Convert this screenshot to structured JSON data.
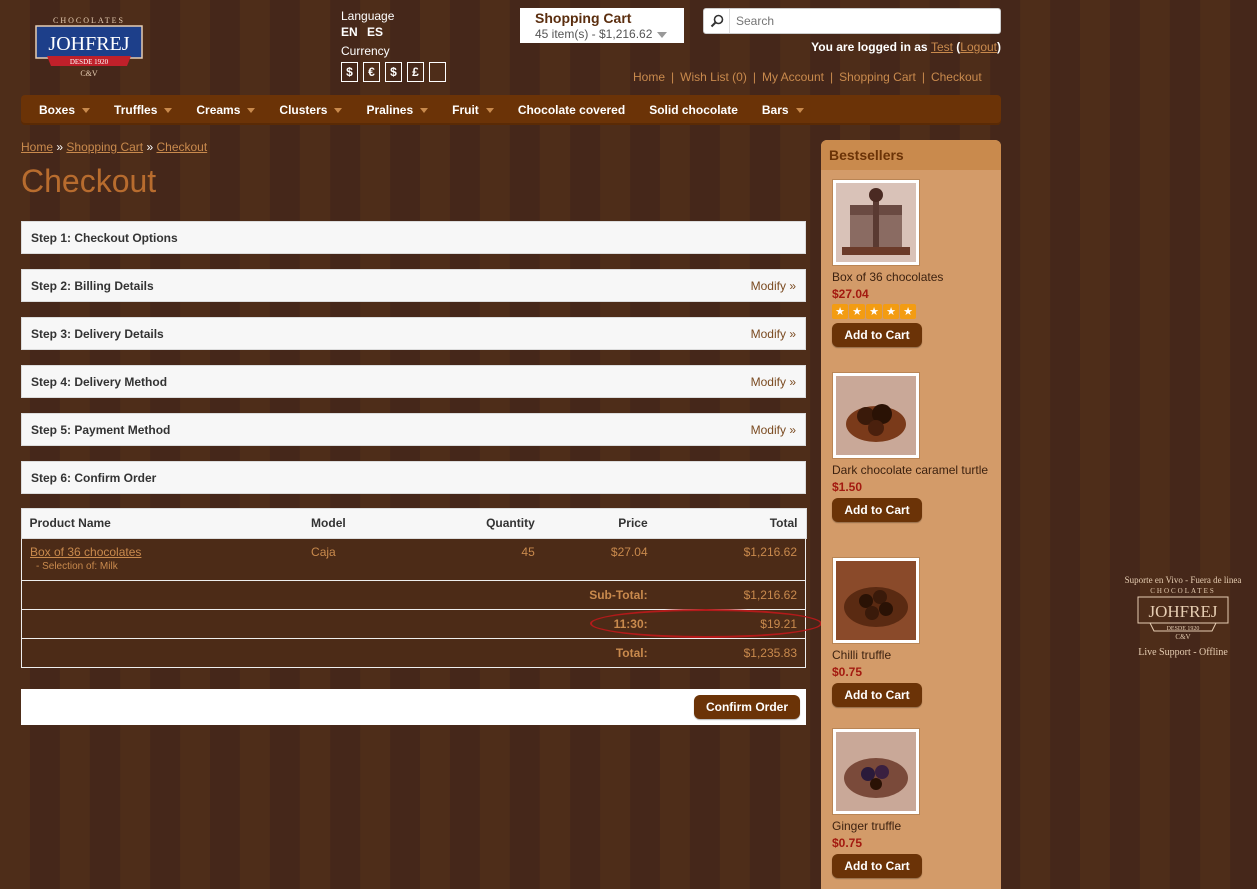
{
  "brand": {
    "top": "CHOCOLATES",
    "name": "JOHFREJ",
    "ribbon": "DESDE 1920",
    "sub": "C&V"
  },
  "header": {
    "language_title": "Language",
    "languages": [
      "EN",
      "ES"
    ],
    "currency_title": "Currency",
    "currencies": [
      "$",
      "€",
      "$",
      "£",
      ""
    ],
    "cart_title": "Shopping Cart",
    "cart_summary": "45 item(s) - $1,216.62",
    "search_placeholder": "Search",
    "logged_prefix": "You are logged in as",
    "logged_user": "Test",
    "logout_label": "Logout",
    "top_links": [
      "Home",
      "Wish List (0)",
      "My Account",
      "Shopping Cart",
      "Checkout"
    ]
  },
  "nav": [
    {
      "label": "Boxes",
      "dropdown": true
    },
    {
      "label": "Truffles",
      "dropdown": true
    },
    {
      "label": "Creams",
      "dropdown": true
    },
    {
      "label": "Clusters",
      "dropdown": true
    },
    {
      "label": "Pralines",
      "dropdown": true
    },
    {
      "label": "Fruit",
      "dropdown": true
    },
    {
      "label": "Chocolate covered",
      "dropdown": false
    },
    {
      "label": "Solid chocolate",
      "dropdown": false
    },
    {
      "label": "Bars",
      "dropdown": true
    }
  ],
  "breadcrumb": [
    "Home",
    "Shopping Cart",
    "Checkout"
  ],
  "breadcrumb_sep": "»",
  "page_title": "Checkout",
  "steps": [
    {
      "title": "Step 1: Checkout Options",
      "modify": ""
    },
    {
      "title": "Step 2: Billing Details",
      "modify": "Modify »"
    },
    {
      "title": "Step 3: Delivery Details",
      "modify": "Modify »"
    },
    {
      "title": "Step 4: Delivery Method",
      "modify": "Modify »"
    },
    {
      "title": "Step 5: Payment Method",
      "modify": "Modify »"
    },
    {
      "title": "Step 6: Confirm Order",
      "modify": ""
    }
  ],
  "cart_table": {
    "headers": [
      "Product Name",
      "Model",
      "Quantity",
      "Price",
      "Total"
    ],
    "product": {
      "name": "Box of 36 chocolates",
      "option": "- Selection of: Milk",
      "model": "Caja",
      "quantity": "45",
      "price": "$27.04",
      "total": "$1,216.62"
    },
    "totals": [
      {
        "label": "Sub-Total:",
        "value": "$1,216.62"
      },
      {
        "label": "11:30:",
        "value": "$19.21"
      },
      {
        "label": "Total:",
        "value": "$1,235.83"
      }
    ]
  },
  "confirm_label": "Confirm Order",
  "sidebar": {
    "title": "Bestsellers",
    "add_label": "Add to Cart",
    "items": [
      {
        "name": "Box of 36 chocolates",
        "price": "$27.04",
        "rating": 5
      },
      {
        "name": "Dark chocolate caramel turtle",
        "price": "$1.50",
        "rating": 0
      },
      {
        "name": "Chilli truffle",
        "price": "$0.75",
        "rating": 0
      },
      {
        "name": "Ginger truffle",
        "price": "$0.75",
        "rating": 0
      }
    ]
  },
  "support": {
    "top": "Suporte en Vivo - Fuera de linea",
    "bottom": "Live Support - Offline"
  },
  "colors": {
    "background": "#4a2a17",
    "nav": "#6b3307",
    "accent_link": "#c98a4d",
    "title": "#b86c2e",
    "sidebar": "#d39b69",
    "price_red": "#a31a10",
    "highlight_ring": "#b31a1a"
  },
  "icons": {
    "search": "magnifier-icon",
    "cart_caret": "chevron-down-icon",
    "nav_dropdown": "chevron-down-icon",
    "rating": "star-icon"
  }
}
